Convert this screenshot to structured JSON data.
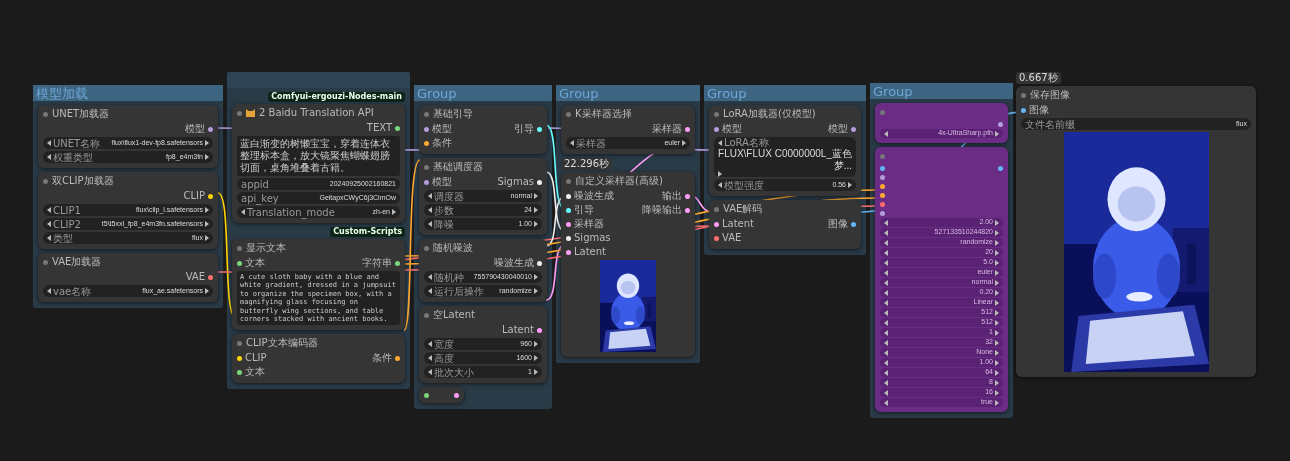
{
  "groups": [
    {
      "kind": "titled",
      "title": "模型加载"
    },
    {
      "kind": "untitled"
    },
    {
      "kind": "titled",
      "title": "Group"
    },
    {
      "kind": "titled",
      "title": "Group"
    },
    {
      "kind": "titled",
      "title": "Group"
    },
    {
      "kind": "titled",
      "title": "Group"
    }
  ],
  "badges": [
    {
      "kind": "pack",
      "text": "Comfyui-ergouzi-Nodes-main"
    },
    {
      "kind": "pack",
      "text": "Custom-Scripts"
    },
    {
      "kind": "timer",
      "text": "22.296秒"
    },
    {
      "kind": "timer",
      "text": "0.667秒"
    }
  ],
  "nodes": [
    {
      "title": "UNET加载器",
      "bypassed": false,
      "outputs": [
        {
          "label": "模型",
          "color": "#b39ddb"
        }
      ],
      "widgets": [
        {
          "label": "UNET名称",
          "value": "flux\\flux1-dev-fp8.safetensors",
          "kind": "combo"
        },
        {
          "label": "权重类型",
          "value": "fp8_e4m3fn",
          "kind": "combo"
        }
      ]
    },
    {
      "title": "双CLIP加载器",
      "bypassed": false,
      "outputs": [
        {
          "label": "CLIP",
          "color": "#ffd500"
        }
      ],
      "widgets": [
        {
          "label": "CLIP1",
          "value": "flux\\clip_l.safetensors",
          "kind": "combo"
        },
        {
          "label": "CLIP2",
          "value": "t5\\t5xxl_fp8_e4m3fn.safetensors",
          "kind": "combo"
        },
        {
          "label": "类型",
          "value": "flux",
          "kind": "combo"
        }
      ]
    },
    {
      "title": "VAE加载器",
      "bypassed": false,
      "outputs": [
        {
          "label": "VAE",
          "color": "#ff6e6e"
        }
      ],
      "widgets": [
        {
          "label": "vae名称",
          "value": "flux_ae.safetensors",
          "kind": "combo"
        }
      ]
    },
    {
      "title": "2 Baidu Translation API",
      "bypassed": false,
      "outputs": [
        {
          "label": "TEXT",
          "color": "#7cd67c"
        }
      ],
      "text": "蓝白渐变的树懒宝宝，穿着连体衣整理标本盒，放大镜聚焦蝴蝶翅膀切面，桌角堆叠着古籍。",
      "widgets": [
        {
          "label": "appid",
          "value": "20240925002160821",
          "kind": "text"
        },
        {
          "label": "api_key",
          "value": "GeltapxCWyC6j3CimOw",
          "kind": "text"
        },
        {
          "label": "Translation_mode",
          "value": "zh-en",
          "kind": "combo"
        }
      ]
    },
    {
      "title": "显示文本",
      "bypassed": false,
      "inputs": [
        {
          "label": "文本",
          "color": "#7cd67c"
        }
      ],
      "outputs": [
        {
          "label": "字符串",
          "color": "#7cd67c"
        }
      ],
      "text": "A cute sloth baby with a blue and white gradient, dressed in a jumpsuit to organize the specimen box, with a magnifying glass focusing on butterfly wing sections, and table corners stacked with ancient books."
    },
    {
      "title": "CLIP文本编码器",
      "bypassed": false,
      "inputs": [
        {
          "label": "CLIP",
          "color": "#ffd500"
        },
        {
          "label": "文本",
          "color": "#7cd67c"
        }
      ],
      "outputs": [
        {
          "label": "条件",
          "color": "#ffa931"
        }
      ]
    },
    {
      "title": "基础引导",
      "bypassed": false,
      "inputs": [
        {
          "label": "模型",
          "color": "#b39ddb"
        },
        {
          "label": "条件",
          "color": "#ffa931"
        }
      ],
      "outputs": [
        {
          "label": "引导",
          "color": "#66ffff"
        }
      ]
    },
    {
      "title": "基础调度器",
      "bypassed": false,
      "inputs": [
        {
          "label": "模型",
          "color": "#b39ddb"
        }
      ],
      "outputs": [
        {
          "label": "Sigmas",
          "color": "#f0f0f0"
        }
      ],
      "widgets": [
        {
          "label": "调度器",
          "value": "normal",
          "kind": "combo"
        },
        {
          "label": "步数",
          "value": "24",
          "kind": "combo"
        },
        {
          "label": "降噪",
          "value": "1.00",
          "kind": "combo"
        }
      ]
    },
    {
      "title": "随机噪波",
      "bypassed": false,
      "outputs": [
        {
          "label": "噪波生成",
          "color": "#f0f0f0"
        }
      ],
      "widgets": [
        {
          "label": "随机种",
          "value": "755790430040010",
          "kind": "combo"
        },
        {
          "label": "运行后操作",
          "value": "randomize",
          "kind": "combo"
        }
      ]
    },
    {
      "title": "空Latent",
      "bypassed": false,
      "outputs": [
        {
          "label": "Latent",
          "color": "#ff9cf9"
        }
      ],
      "widgets": [
        {
          "label": "宽度",
          "value": "960",
          "kind": "combo"
        },
        {
          "label": "高度",
          "value": "1600",
          "kind": "combo"
        },
        {
          "label": "批次大小",
          "value": "1",
          "kind": "combo"
        }
      ]
    },
    {
      "kind": "collapsed",
      "bypassed": false,
      "inputs": [
        {
          "color": "#7cd67c"
        }
      ],
      "outputs": [
        {
          "color": "#ff9cf9"
        }
      ]
    },
    {
      "title": "K采样器选择",
      "bypassed": false,
      "outputs": [
        {
          "label": "采样器",
          "color": "#ff9cf9"
        }
      ],
      "widgets": [
        {
          "label": "采样器",
          "value": "euler",
          "kind": "combo"
        }
      ]
    },
    {
      "title": "自定义采样器(高级)",
      "bypassed": false,
      "inputs": [
        {
          "label": "噪波生成",
          "color": "#f0f0f0"
        },
        {
          "label": "引导",
          "color": "#66ffff"
        },
        {
          "label": "采样器",
          "color": "#ff9cf9"
        },
        {
          "label": "Sigmas",
          "color": "#f0f0f0"
        },
        {
          "label": "Latent",
          "color": "#ff9cf9"
        }
      ],
      "outputs": [
        {
          "label": "输出",
          "color": "#ff9cf9"
        },
        {
          "label": "降噪输出",
          "color": "#ff9cf9"
        }
      ],
      "image": {
        "kind": "picture"
      }
    },
    {
      "title": "LoRA加载器(仅模型)",
      "bypassed": false,
      "inputs": [
        {
          "label": "模型",
          "color": "#b39ddb"
        }
      ],
      "outputs": [
        {
          "label": "模型",
          "color": "#b39ddb"
        }
      ],
      "widgets": [
        {
          "label": "LoRA名称",
          "value": "FLUX\\FLUX C0000000L_蓝色梦...",
          "kind": "combo"
        },
        {
          "label": "模型强度",
          "value": "0.56",
          "kind": "combo"
        }
      ]
    },
    {
      "title": "VAE解码",
      "bypassed": false,
      "inputs": [
        {
          "label": "Latent",
          "color": "#ff9cf9"
        },
        {
          "label": "VAE",
          "color": "#ff6e6e"
        }
      ],
      "outputs": [
        {
          "label": "图像",
          "color": "#64b5f6"
        }
      ]
    },
    {
      "bypassed": true,
      "outputs": [
        {
          "color": "#b39ddb"
        }
      ],
      "widgets": [
        {
          "value": "4x-UltraSharp.pth",
          "kind": "combo"
        }
      ]
    },
    {
      "bypassed": true,
      "inputs": [
        {
          "color": "#64b5f6"
        },
        {
          "color": "#b39ddb"
        },
        {
          "color": "#ffa931"
        },
        {
          "color": "#ffa931"
        },
        {
          "color": "#ff6e6e"
        },
        {
          "color": "#b39ddb"
        }
      ],
      "outputs": [
        {
          "color": "#64b5f6"
        }
      ],
      "widgets": [
        {
          "value": "2.00",
          "kind": "combo"
        },
        {
          "value": "527133510244820",
          "kind": "combo"
        },
        {
          "value": "randomize",
          "kind": "combo"
        },
        {
          "value": "20",
          "kind": "combo"
        },
        {
          "value": "5.0",
          "kind": "combo"
        },
        {
          "value": "euler",
          "kind": "combo"
        },
        {
          "value": "normal",
          "kind": "combo"
        },
        {
          "value": "0.20",
          "kind": "combo"
        },
        {
          "value": "Linear",
          "kind": "combo"
        },
        {
          "value": "512",
          "kind": "combo"
        },
        {
          "value": "512",
          "kind": "combo"
        },
        {
          "value": "1",
          "kind": "combo"
        },
        {
          "value": "32",
          "kind": "combo"
        },
        {
          "value": "None",
          "kind": "combo"
        },
        {
          "value": "1.00",
          "kind": "combo"
        },
        {
          "value": "64",
          "kind": "combo"
        },
        {
          "value": "8",
          "kind": "combo"
        },
        {
          "value": "16",
          "kind": "combo"
        },
        {
          "value": "true",
          "kind": "combo"
        }
      ]
    },
    {
      "title": "保存图像",
      "bypassed": false,
      "inputs": [
        {
          "label": "图像",
          "color": "#64b5f6"
        }
      ],
      "widgets": [
        {
          "label": "文件名前缀",
          "value": "flux",
          "kind": "text"
        }
      ],
      "image": {
        "kind": "picture"
      }
    }
  ]
}
